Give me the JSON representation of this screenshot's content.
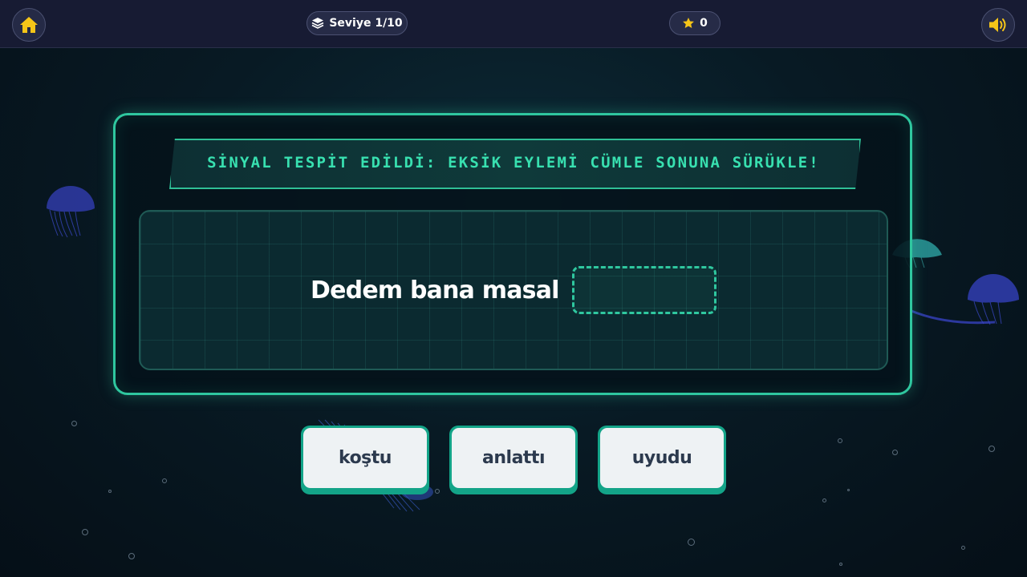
{
  "header": {
    "level_label": "Seviye 1/10",
    "score": "0",
    "icons": {
      "home": "home-icon",
      "level": "layers-icon",
      "score": "star-icon",
      "sound": "volume-icon"
    }
  },
  "challenge": {
    "instruction": "SİNYAL TESPİT EDİLDİ: EKSİK EYLEMİ CÜMLE SONUNA SÜRÜKLE!",
    "sentence": "Dedem bana masal",
    "dropzone_value": ""
  },
  "options": [
    {
      "label": "koştu"
    },
    {
      "label": "anlattı"
    },
    {
      "label": "uyudu"
    }
  ],
  "colors": {
    "accent": "#2fc79f",
    "icon_yellow": "#f5c518",
    "topbar": "#171b33",
    "card_face": "#eef2f4",
    "card_text": "#2c3a4e"
  }
}
